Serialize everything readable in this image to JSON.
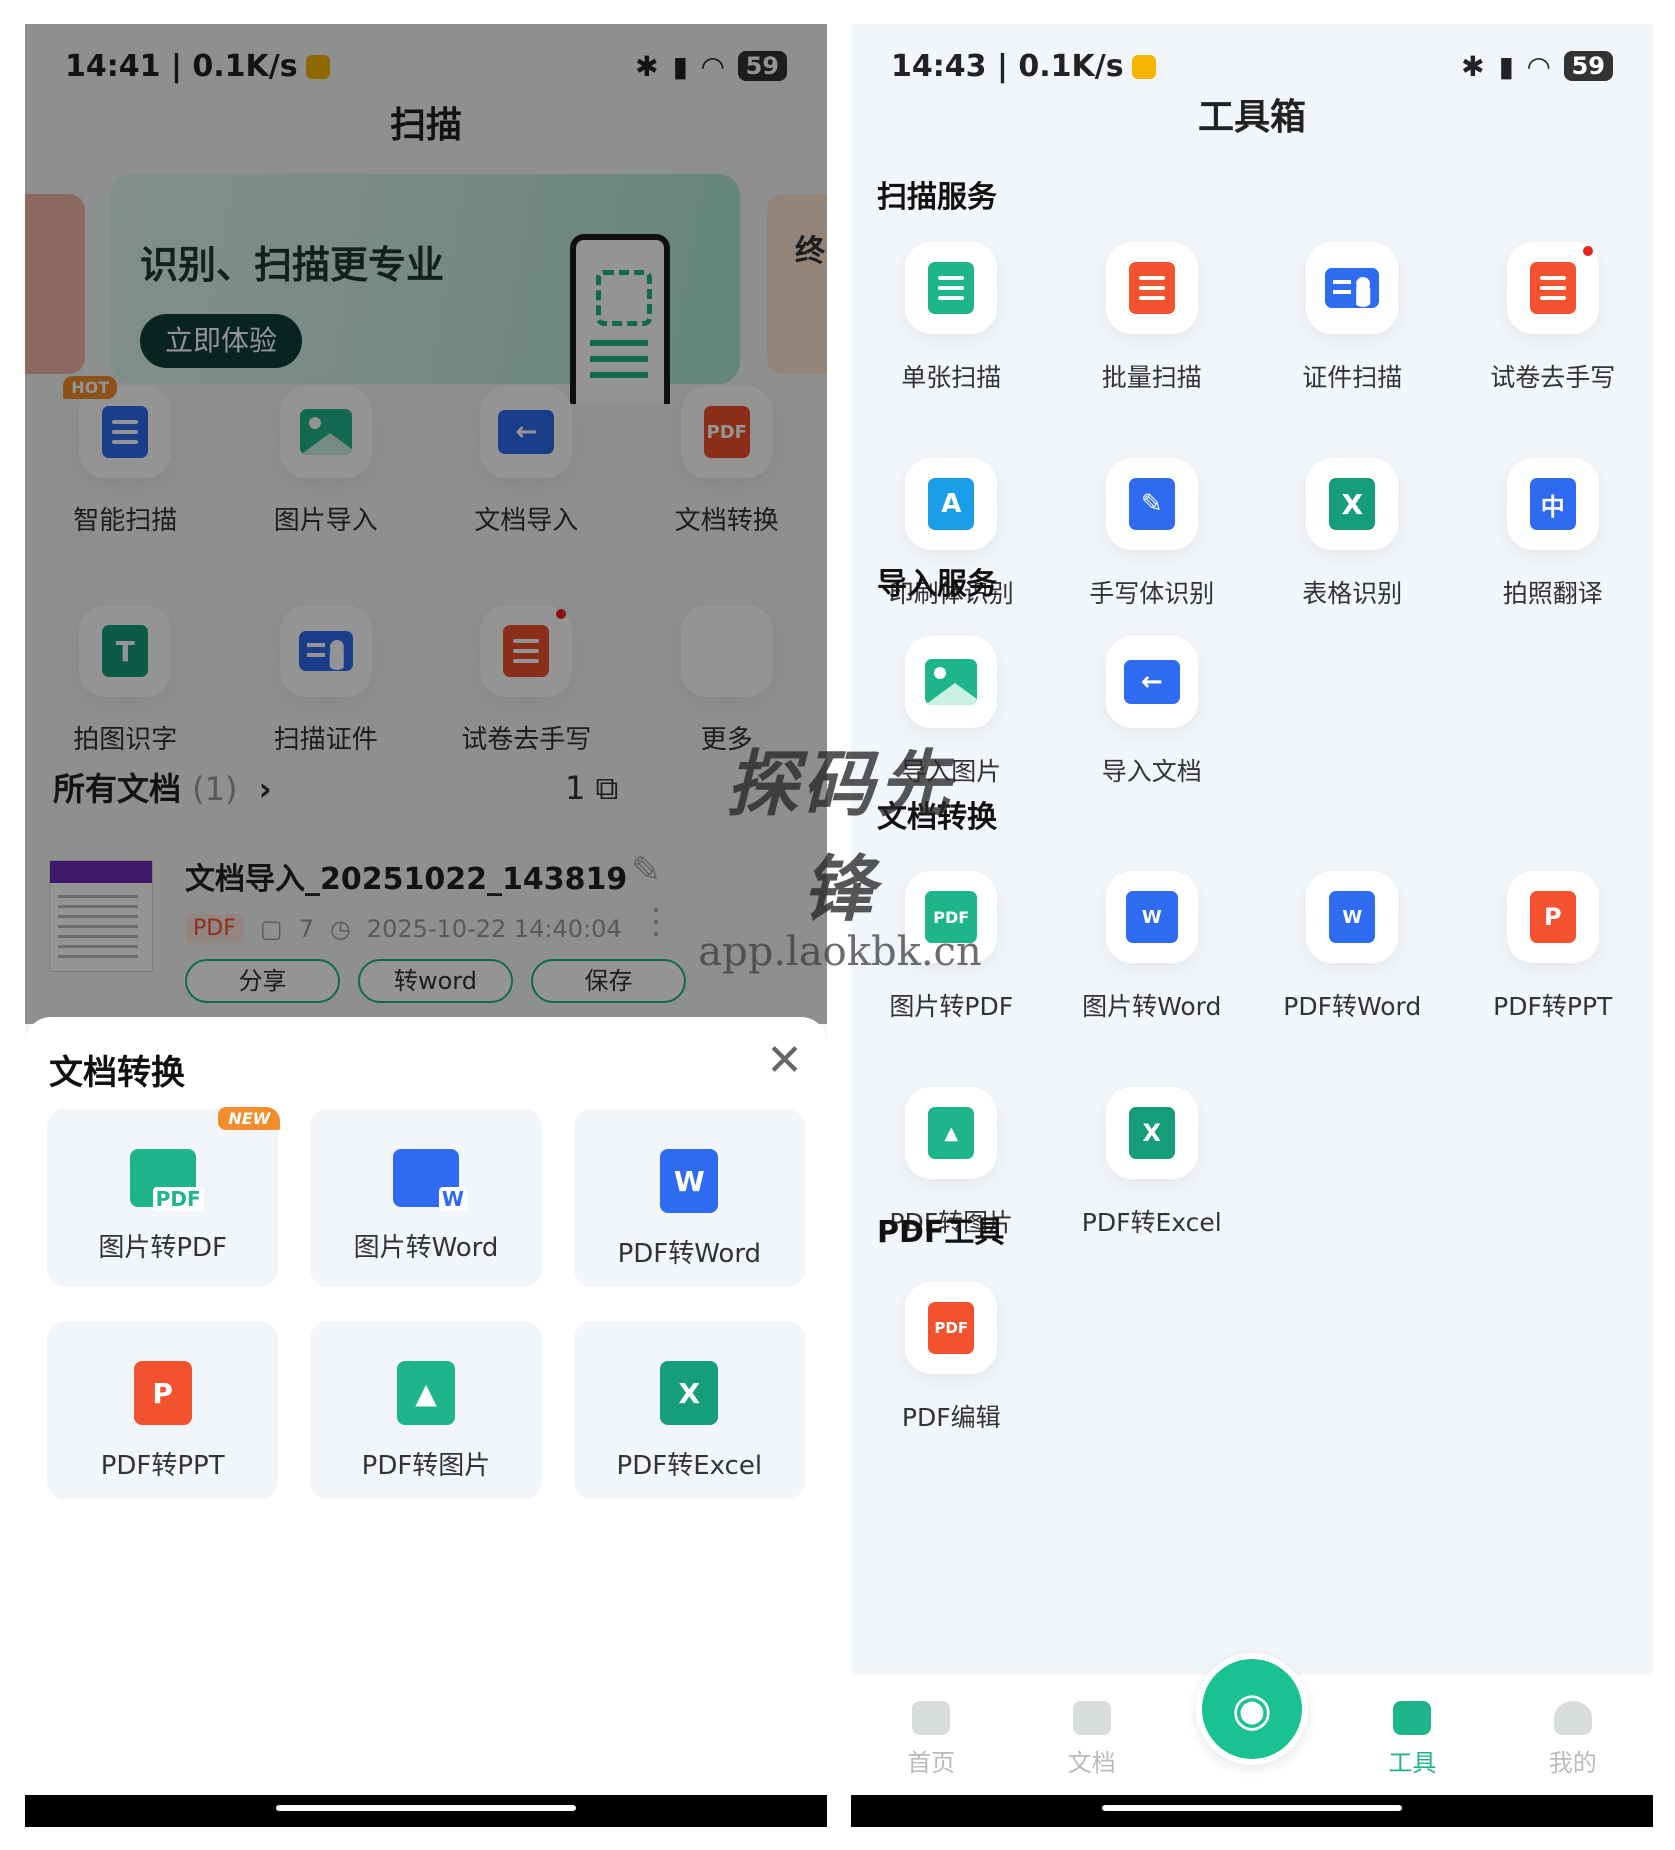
{
  "left": {
    "status": {
      "time": "14:41 | 0.1K/s",
      "battery": "59"
    },
    "title": "扫描",
    "banner": {
      "headline": "识别、扫描更专业",
      "button": "立即体验",
      "side_text": "终"
    },
    "quick_actions": [
      {
        "label": "智能扫描",
        "badge": "HOT",
        "icon": "smart-scan-icon"
      },
      {
        "label": "图片导入",
        "icon": "image-import-icon"
      },
      {
        "label": "文档导入",
        "icon": "doc-import-icon"
      },
      {
        "label": "文档转换",
        "icon": "pdf-convert-icon",
        "icon_text": "PDF"
      },
      {
        "label": "拍图识字",
        "icon": "ocr-text-icon",
        "icon_text": "T"
      },
      {
        "label": "扫描证件",
        "icon": "id-card-icon"
      },
      {
        "label": "试卷去手写",
        "icon": "erase-handwriting-icon",
        "dot": true
      },
      {
        "label": "更多",
        "icon": "grid-more-icon"
      }
    ],
    "documents": {
      "heading": "所有文档",
      "count": "(1)",
      "tools_text": "1",
      "item": {
        "name": "文档导入_20251022_143819",
        "type": "PDF",
        "pages": "7",
        "datetime": "2025-10-22 14:40:04",
        "actions": [
          "分享",
          "转word",
          "保存"
        ]
      }
    },
    "sheet": {
      "title": "文档转换",
      "close": "✕",
      "items": [
        {
          "label": "图片转PDF",
          "badge": "NEW",
          "icon_text": "PDF"
        },
        {
          "label": "图片转Word",
          "icon_text": "W"
        },
        {
          "label": "PDF转Word",
          "icon_text": "W"
        },
        {
          "label": "PDF转PPT",
          "icon_text": "P"
        },
        {
          "label": "PDF转图片",
          "icon_text": "▲"
        },
        {
          "label": "PDF转Excel",
          "icon_text": "X"
        }
      ]
    }
  },
  "right": {
    "status": {
      "time": "14:43 | 0.1K/s",
      "battery": "59"
    },
    "title": "工具箱",
    "sections": {
      "scan": {
        "title": "扫描服务",
        "items": [
          {
            "label": "单张扫描",
            "icon_text": ""
          },
          {
            "label": "批量扫描",
            "icon_text": ""
          },
          {
            "label": "证件扫描",
            "icon_text": ""
          },
          {
            "label": "试卷去手写",
            "icon_text": "",
            "dot": true
          },
          {
            "label": "印刷体识别",
            "icon_text": "A"
          },
          {
            "label": "手写体识别",
            "icon_text": "✎"
          },
          {
            "label": "表格识别",
            "icon_text": "X"
          },
          {
            "label": "拍照翻译",
            "icon_text": "中"
          }
        ]
      },
      "import": {
        "title": "导入服务",
        "items": [
          {
            "label": "导入图片",
            "icon_text": ""
          },
          {
            "label": "导入文档",
            "icon_text": "←"
          }
        ]
      },
      "convert": {
        "title": "文档转换",
        "items": [
          {
            "label": "图片转PDF",
            "icon_text": "PDF"
          },
          {
            "label": "图片转Word",
            "icon_text": "W"
          },
          {
            "label": "PDF转Word",
            "icon_text": "W"
          },
          {
            "label": "PDF转PPT",
            "icon_text": "P"
          },
          {
            "label": "PDF转图片",
            "icon_text": "▲"
          },
          {
            "label": "PDF转Excel",
            "icon_text": "X"
          }
        ]
      },
      "pdf": {
        "title": "PDF工具",
        "items": [
          {
            "label": "PDF编辑",
            "icon_text": "PDF"
          }
        ]
      }
    },
    "tabbar": [
      "首页",
      "文档",
      "工具",
      "我的"
    ],
    "active_tab": "工具"
  },
  "watermark": {
    "line1": "探码先锋",
    "line2": "app.laokbk.cn"
  },
  "colors": {
    "accent": "#1fb58a",
    "red": "#f2522e",
    "blue": "#2f6bf0",
    "badge_orange": "#f28d2e"
  }
}
